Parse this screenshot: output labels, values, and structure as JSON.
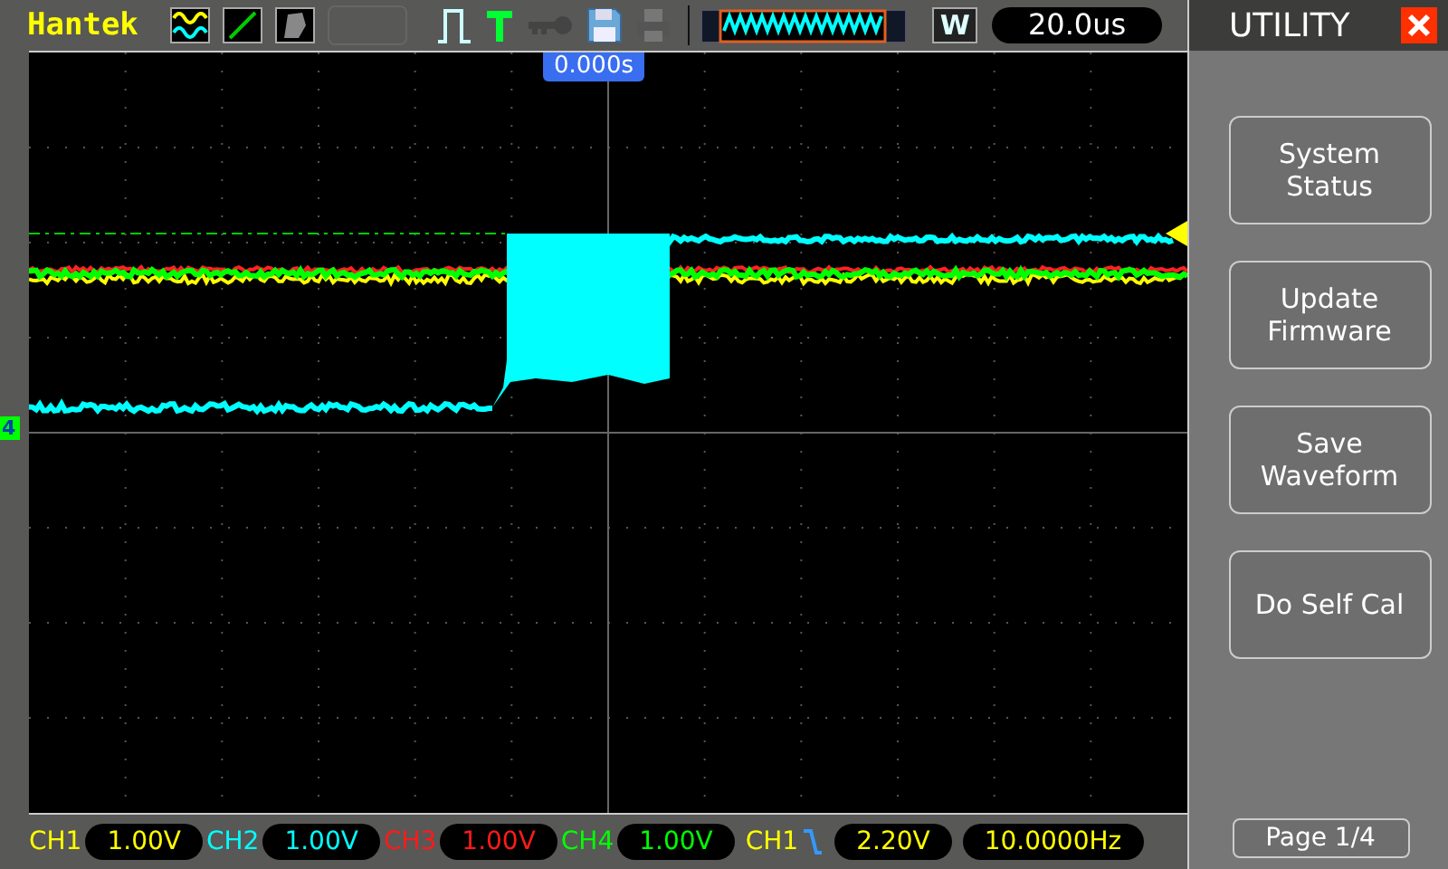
{
  "brand": "Hantek",
  "toolbar": {
    "time_base": "20.0us",
    "window_key": "W"
  },
  "trigger_position": "0.000s",
  "channel_marker": "4",
  "menu": {
    "title": "UTILITY",
    "buttons": [
      {
        "lines": [
          "System",
          "Status"
        ]
      },
      {
        "lines": [
          "Update",
          "Firmware"
        ]
      },
      {
        "lines": [
          "Save",
          "Waveform"
        ]
      },
      {
        "lines": [
          "Do Self Cal"
        ]
      }
    ],
    "page": "Page 1/4"
  },
  "channels": [
    {
      "name": "CH1",
      "scale": "1.00V",
      "color": "#ffff00"
    },
    {
      "name": "CH2",
      "scale": "1.00V",
      "color": "#00ffff"
    },
    {
      "name": "CH3",
      "scale": "1.00V",
      "color": "#ff1a1a"
    },
    {
      "name": "CH4",
      "scale": "1.00V",
      "color": "#00ff00"
    }
  ],
  "trigger": {
    "source": "CH1",
    "level": "2.20V",
    "frequency": "10.0000Hz"
  }
}
